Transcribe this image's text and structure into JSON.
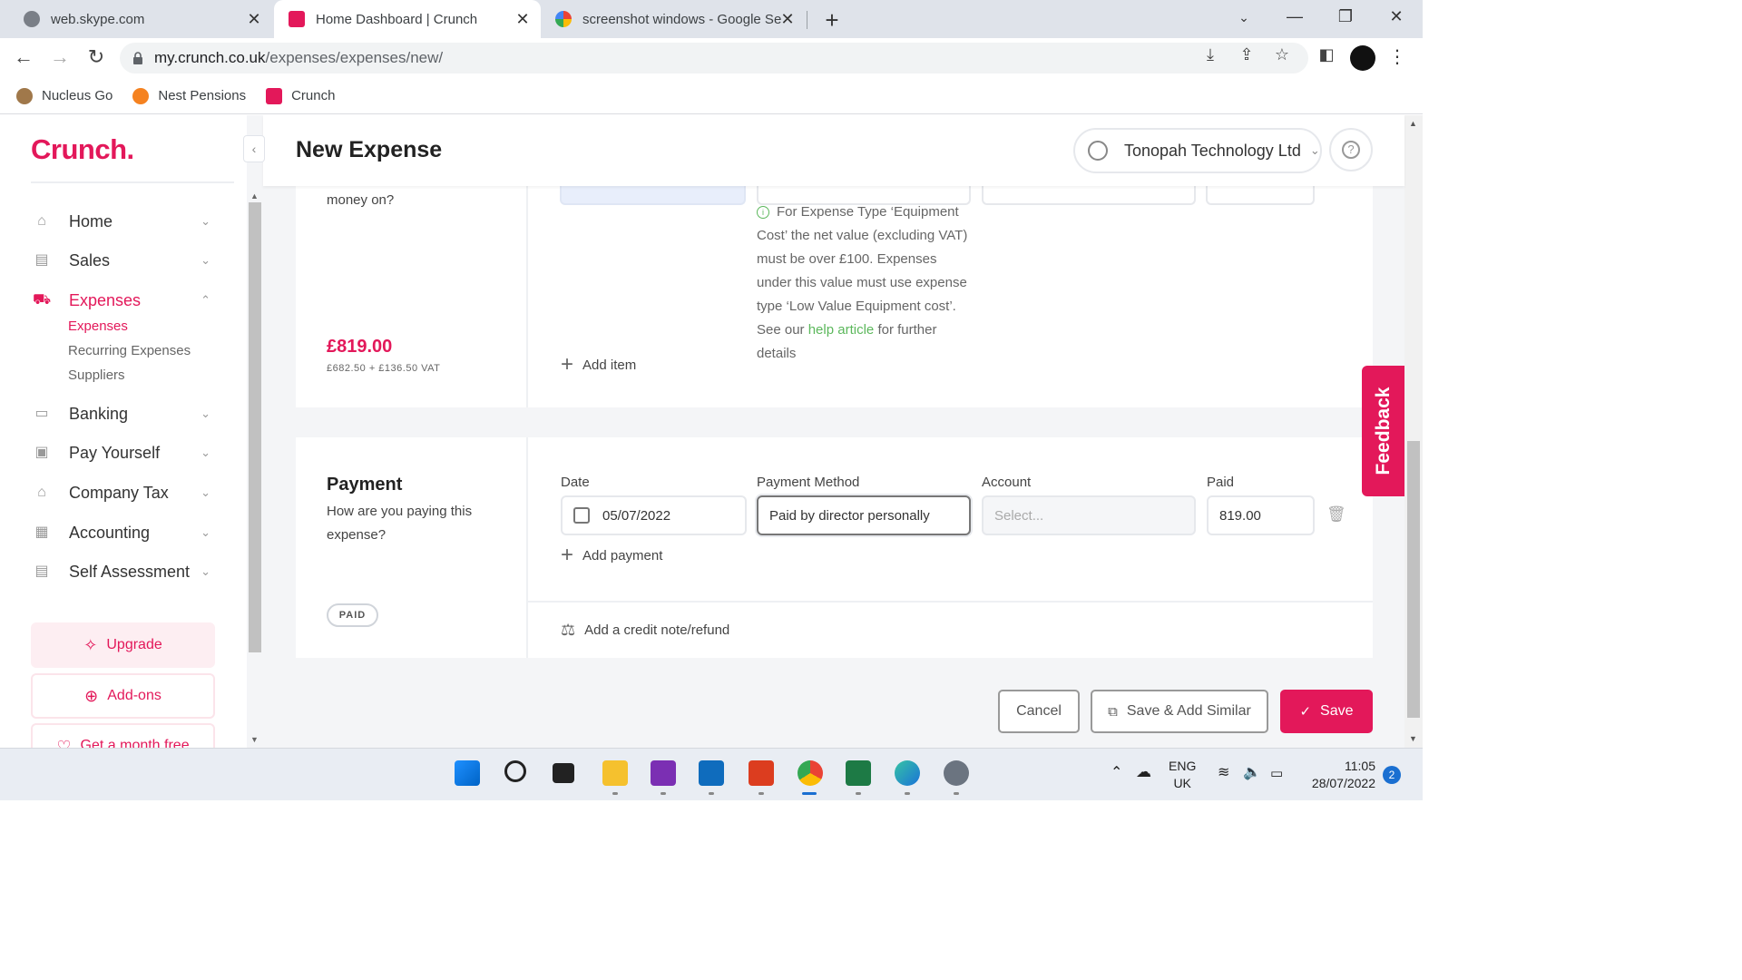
{
  "browser": {
    "tabs": [
      {
        "title": "web.skype.com",
        "active": false
      },
      {
        "title": "Home Dashboard | Crunch",
        "active": true
      },
      {
        "title": "screenshot windows - Google Se",
        "active": false
      }
    ],
    "url_host": "my.crunch.co.uk",
    "url_path": "/expenses/expenses/new/",
    "bookmarks": [
      "Nucleus Go",
      "Nest Pensions",
      "Crunch"
    ]
  },
  "sidebar": {
    "logo": "Crunch.",
    "items": [
      {
        "label": "Home",
        "icon": "home-icon"
      },
      {
        "label": "Sales",
        "icon": "sales-icon"
      },
      {
        "label": "Expenses",
        "icon": "cart-icon"
      },
      {
        "label": "Banking",
        "icon": "bank-card-icon"
      },
      {
        "label": "Pay Yourself",
        "icon": "wallet-icon"
      },
      {
        "label": "Company Tax",
        "icon": "government-icon"
      },
      {
        "label": "Accounting",
        "icon": "calculator-icon"
      },
      {
        "label": "Self Assessment",
        "icon": "document-icon"
      }
    ],
    "expenses_sub": [
      "Expenses",
      "Recurring Expenses",
      "Suppliers"
    ],
    "upgrade_label": "Upgrade",
    "addons_label": "Add-ons",
    "month_free_label": "Get a month free"
  },
  "header": {
    "title": "New Expense",
    "company": "Tonopah Technology Ltd"
  },
  "expense_card": {
    "question_fragment": "money on?",
    "total": "£819.00",
    "total_breakdown": "£682.50 + £136.50 VAT",
    "info_prefix": "For Expense Type ‘Equipment Cost’ the net value (excluding VAT) must be over £100. Expenses under this value must use expense type ‘Low Value Equipment cost’. See our",
    "info_link": "help article",
    "info_suffix": "for further details",
    "add_item": "Add item"
  },
  "payment_card": {
    "title": "Payment",
    "question": "How are you paying this expense?",
    "badge": "PAID",
    "labels": {
      "date": "Date",
      "method": "Payment Method",
      "account": "Account",
      "paid": "Paid"
    },
    "date_value": "05/07/2022",
    "method_value": "Paid by director personally",
    "account_placeholder": "Select...",
    "paid_value": "819.00",
    "add_payment": "Add payment",
    "credit_note": "Add a credit note/refund"
  },
  "actions": {
    "cancel": "Cancel",
    "save_similar": "Save & Add Similar",
    "save": "Save"
  },
  "feedback_label": "Feedback",
  "taskbar": {
    "lang_top": "ENG",
    "lang_bottom": "UK",
    "time": "11:05",
    "date": "28/07/2022",
    "notifications": "2"
  },
  "colors": {
    "brand": "#e3185a",
    "link": "#5cb85c"
  }
}
